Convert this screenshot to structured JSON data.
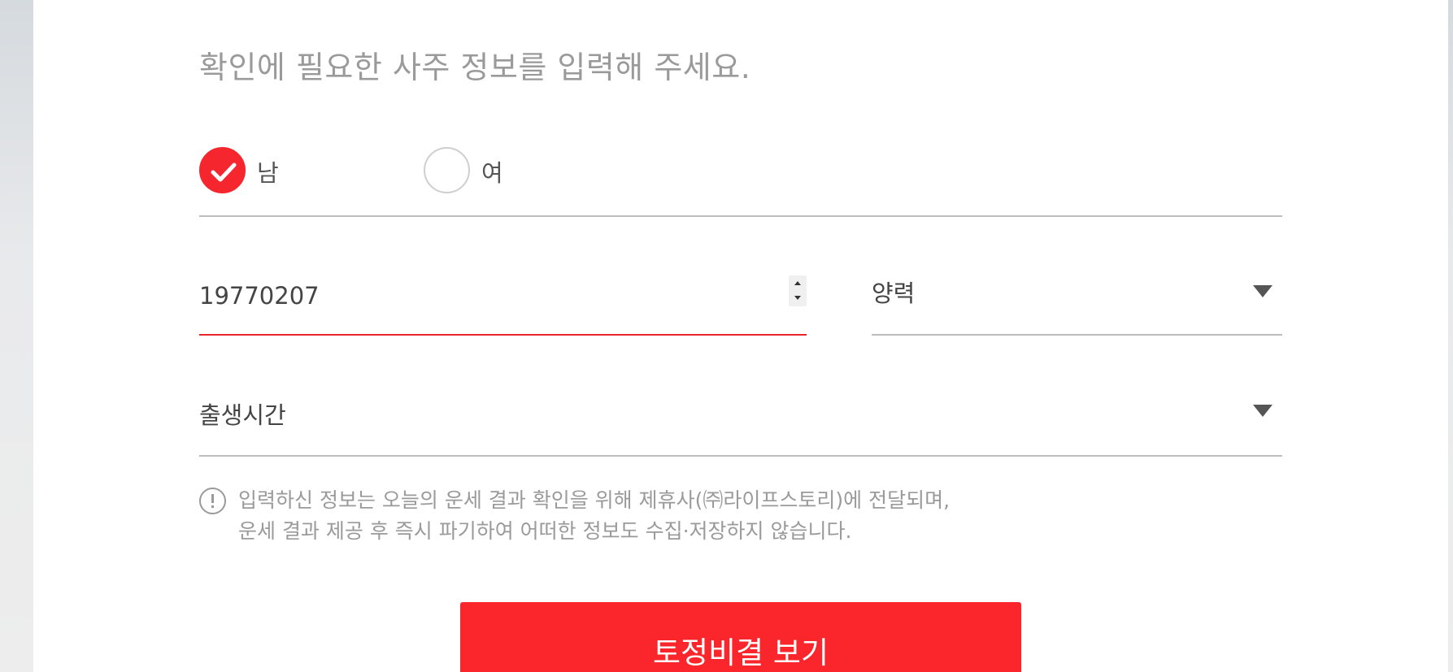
{
  "heading": "확인에 필요한 사주 정보를 입력해 주세요.",
  "gender": {
    "options": [
      {
        "label": "남",
        "checked": true
      },
      {
        "label": "여",
        "checked": false
      }
    ]
  },
  "birth_date": {
    "value": "19770207"
  },
  "calendar_type": {
    "selected": "양력"
  },
  "birth_time": {
    "placeholder": "출생시간"
  },
  "notice": {
    "line1": "입력하신 정보는 오늘의 운세 결과 확인을 위해 제휴사(㈜라이프스토리)에 전달되며,",
    "line2": "운세 결과 제공 후 즉시 파기하여 어떠한 정보도 수집·저장하지 않습니다."
  },
  "submit": {
    "label": "토정비결 보기"
  },
  "colors": {
    "accent": "#fb262b",
    "text_muted": "#9a9a9a",
    "divider": "#bdbdbd"
  },
  "icons": [
    "check-icon",
    "notice-info-icon",
    "chevron-down-icon",
    "spinner-up-icon",
    "spinner-down-icon"
  ]
}
